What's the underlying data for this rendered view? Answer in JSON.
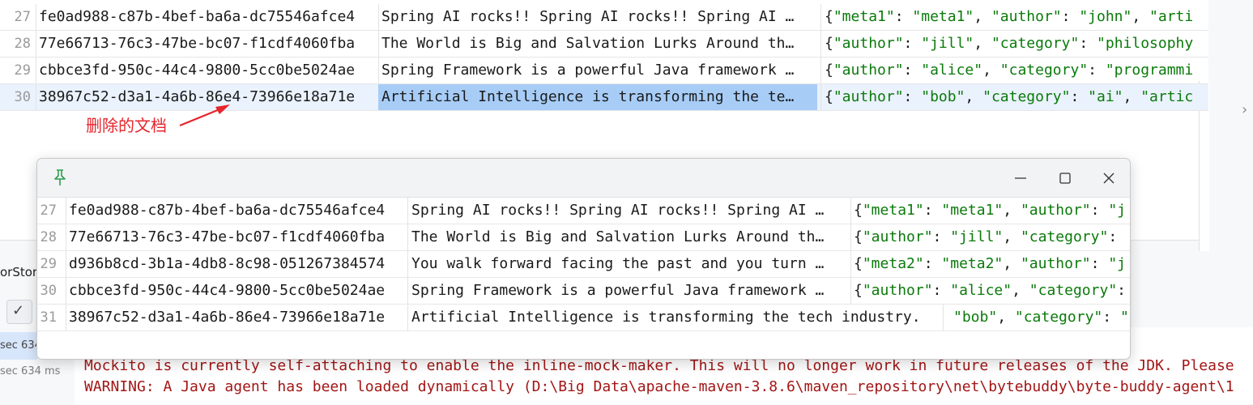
{
  "background_table": {
    "rows": [
      {
        "num": "27",
        "id": "fe0ad988-c87b-4bef-ba6a-dc75546afce4",
        "text": "Spring AI rocks!! Spring AI rocks!! Spring AI …",
        "metadata": "{\"meta1\": \"meta1\", \"author\": \"john\", \"arti"
      },
      {
        "num": "28",
        "id": "77e66713-76c3-47be-bc07-f1cdf4060fba",
        "text": "The World is Big and Salvation Lurks Around th…",
        "metadata": "{\"author\": \"jill\", \"category\": \"philosophy"
      },
      {
        "num": "29",
        "id": "cbbce3fd-950c-44c4-9800-5cc0be5024ae",
        "text": "Spring Framework is a powerful Java framework …",
        "metadata": "{\"author\": \"alice\", \"category\": \"programmi"
      },
      {
        "num": "30",
        "id": "38967c52-d3a1-4a6b-86e4-73966e18a71e",
        "text": "Artificial Intelligence is transforming the te…",
        "metadata": "{\"author\": \"bob\", \"category\": \"ai\", \"artic"
      }
    ]
  },
  "annotation": {
    "label": "删除的文档",
    "color": "#e6252c"
  },
  "floating_window": {
    "rows": [
      {
        "num": "27",
        "id": "fe0ad988-c87b-4bef-ba6a-dc75546afce4",
        "text": "Spring AI rocks!! Spring AI rocks!! Spring AI …",
        "metadata": "{\"meta1\": \"meta1\", \"author\": \"j"
      },
      {
        "num": "28",
        "id": "77e66713-76c3-47be-bc07-f1cdf4060fba",
        "text": "The World is Big and Salvation Lurks Around th…",
        "metadata": "{\"author\": \"jill\", \"category\":"
      },
      {
        "num": "29",
        "id": "d936b8cd-3b1a-4db8-8c98-051267384574",
        "text": "You walk forward facing the past and you turn …",
        "metadata": "{\"meta2\": \"meta2\", \"author\": \"j"
      },
      {
        "num": "30",
        "id": "cbbce3fd-950c-44c4-9800-5cc0be5024ae",
        "text": "Spring Framework is a powerful Java framework …",
        "metadata": "{\"author\": \"alice\", \"category\":"
      },
      {
        "num": "31",
        "id": "38967c52-d3a1-4a6b-86e4-73966e18a71e",
        "text": "Artificial Intelligence is transforming the tech industry.",
        "metadata": "\"bob\", \"category\": \""
      }
    ]
  },
  "side_panel": {
    "tab_label": "orStor",
    "time1": "sec 634",
    "time2": "sec 634 ms"
  },
  "console": {
    "line1": "Mockito is currently self-attaching to enable the inline-mock-maker. This will no longer work in future releases of the JDK. Please",
    "line2": "WARNING: A Java agent has been loaded dynamically (D:\\Big Data\\apache-maven-3.8.6\\maven_repository\\net\\bytebuddy\\byte-buddy-agent\\1"
  }
}
